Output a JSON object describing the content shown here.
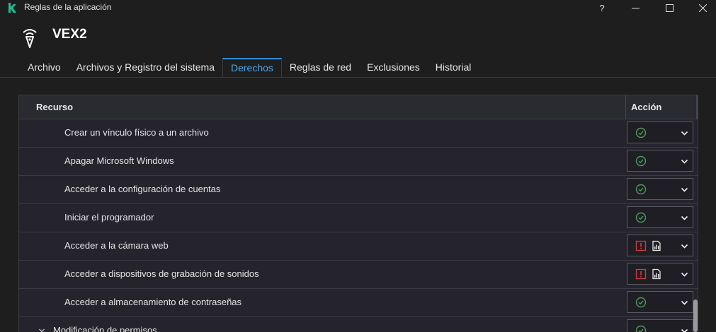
{
  "window": {
    "title": "Reglas de la aplicación",
    "help": "?",
    "minimize": "—",
    "maximize": "☐",
    "close": "✕"
  },
  "app": {
    "name": "VEX2"
  },
  "tabs": [
    {
      "label": "Archivo"
    },
    {
      "label": "Archivos y Registro del sistema"
    },
    {
      "label": "Derechos"
    },
    {
      "label": "Reglas de red"
    },
    {
      "label": "Exclusiones"
    },
    {
      "label": "Historial"
    }
  ],
  "active_tab": "Derechos",
  "table": {
    "col_resource": "Recurso",
    "col_action": "Acción",
    "rows": [
      {
        "label": "Crear un vínculo físico a un archivo",
        "action": "allow"
      },
      {
        "label": "Apagar Microsoft Windows",
        "action": "allow"
      },
      {
        "label": "Acceder a la configuración de cuentas",
        "action": "allow"
      },
      {
        "label": "Iniciar el programador",
        "action": "allow"
      },
      {
        "label": "Acceder a la cámara web",
        "action": "block-log"
      },
      {
        "label": "Acceder a dispositivos de grabación de sonidos",
        "action": "block-log"
      },
      {
        "label": "Acceder a almacenamiento de contraseñas",
        "action": "allow"
      }
    ],
    "group_row": {
      "label": "Modificación de permisos",
      "action": "allow"
    }
  },
  "colors": {
    "accent": "#2f8fd6",
    "ok": "#4f9a5a",
    "block": "#d23c3c",
    "logo": "#1fbf8f"
  },
  "icons": {
    "allow": "check-circle-icon",
    "block": "exclamation-box-icon",
    "log": "report-icon",
    "dropdown": "chevron-down-icon"
  }
}
